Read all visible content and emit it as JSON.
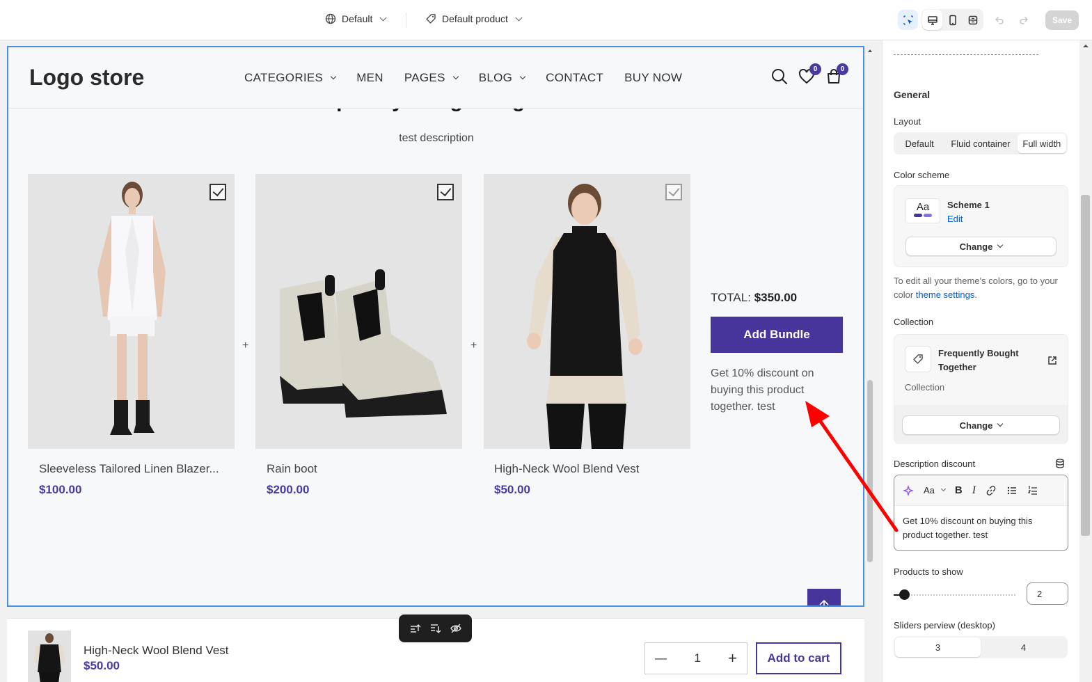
{
  "topbar": {
    "market": "Default",
    "template": "Default product",
    "save": "Save"
  },
  "store": {
    "logo": "Logo store",
    "nav": [
      "CATEGORIES",
      "MEN",
      "PAGES",
      "BLOG",
      "CONTACT",
      "BUY NOW"
    ],
    "wishlist_count": "0",
    "cart_count": "0"
  },
  "section": {
    "title": "Frequently Bought Together",
    "description": "test description",
    "products": [
      {
        "name": "Sleeveless Tailored Linen Blazer...",
        "price": "$100.00"
      },
      {
        "name": "Rain boot",
        "price": "$200.00"
      },
      {
        "name": "High-Neck Wool Blend Vest",
        "price": "$50.00"
      }
    ],
    "plus": "+",
    "total_label": "TOTAL:",
    "total_value": "$350.00",
    "bundle_button": "Add Bundle",
    "discount_text": "Get 10% discount on buying this product together. test"
  },
  "sticky": {
    "name": "High-Neck Wool Blend Vest",
    "price": "$50.00",
    "qty": "1",
    "add_to_cart": "Add to cart"
  },
  "panel": {
    "general": "General",
    "layout_label": "Layout",
    "layout_options": [
      "Default",
      "Fluid container",
      "Full width"
    ],
    "color_scheme_label": "Color scheme",
    "scheme_name": "Scheme 1",
    "scheme_edit": "Edit",
    "scheme_swatch": "Aa",
    "change": "Change",
    "help_text_pre": "To edit all your theme's colors, go to your color ",
    "help_link": "theme settings",
    "help_text_post": ".",
    "collection_label": "Collection",
    "collection_name": "Frequently Bought Together",
    "collection_sub": "Collection",
    "description_discount_label": "Description discount",
    "rte_font": "Aa",
    "rte_text": "Get 10% discount on buying this product together. test",
    "products_to_show_label": "Products to show",
    "products_to_show_value": "2",
    "sliders_label": "Sliders perview (desktop)",
    "sliders_options": [
      "3",
      "4"
    ]
  },
  "colors": {
    "brand": "#47359c",
    "selection": "#4a90e2",
    "annotation_arrow": "#ff0000"
  }
}
